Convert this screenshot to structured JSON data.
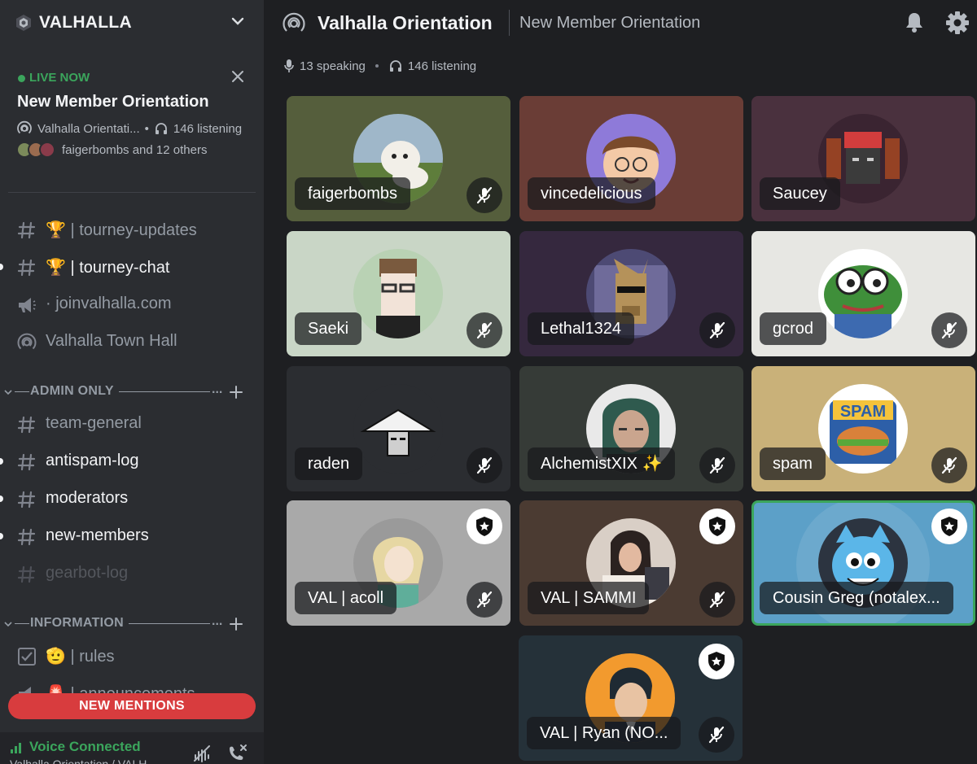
{
  "server": {
    "name": "VALHALLA"
  },
  "live": {
    "status": "LIVE NOW",
    "title": "New Member Orientation",
    "channel": "Valhalla Orientati...",
    "listening": "146 listening",
    "people": "faigerbombs and 12 others"
  },
  "channels": [
    {
      "label": "🏆 | tourney-updates",
      "type": "text",
      "state": "normal"
    },
    {
      "label": "🏆 | tourney-chat",
      "type": "text",
      "state": "unread"
    },
    {
      "label": "· joinvalhalla.com",
      "type": "announce",
      "state": "normal"
    },
    {
      "label": "Valhalla Town Hall",
      "type": "stage",
      "state": "normal"
    },
    {
      "label": "team-general",
      "type": "text",
      "state": "normal"
    },
    {
      "label": "antispam-log",
      "type": "text",
      "state": "unread"
    },
    {
      "label": "moderators",
      "type": "text",
      "state": "unread"
    },
    {
      "label": "new-members",
      "type": "text",
      "state": "unread"
    },
    {
      "label": "gearbot-log",
      "type": "text",
      "state": "muted"
    },
    {
      "label": "🫡 | rules",
      "type": "rules",
      "state": "normal"
    },
    {
      "label": "🚨 | announcements",
      "type": "announce",
      "state": "normal"
    }
  ],
  "categories": [
    {
      "label": "ADMIN ONLY",
      "dots": "..."
    },
    {
      "label": "INFORMATION",
      "dots": "..."
    }
  ],
  "new_mentions": "NEW MENTIONS",
  "voice": {
    "status": "Voice Connected",
    "sub": "Valhalla Orientation / VALH..."
  },
  "stage": {
    "title": "Valhalla Orientation",
    "topic": "New Member Orientation",
    "speaking": "13 speaking",
    "listening": "146 listening"
  },
  "speakers": [
    {
      "name": "faigerbombs",
      "tile_color": "#555e3c",
      "avatar": "dog-photo",
      "moderator": false,
      "speaking": false
    },
    {
      "name": "vincedelicious",
      "tile_color": "#6a3d36",
      "avatar": "cartoon-glasses",
      "moderator": false,
      "speaking": false
    },
    {
      "name": "Saucey",
      "tile_color": "#4a313e",
      "avatar": "pixel-creature",
      "moderator": false,
      "speaking": false
    },
    {
      "name": "Saeki",
      "tile_color": "#c9d6c6",
      "avatar": "pixel-face",
      "moderator": false,
      "speaking": false
    },
    {
      "name": "Lethal1324",
      "tile_color": "#35283e",
      "avatar": "pixel-llama",
      "moderator": false,
      "speaking": false
    },
    {
      "name": "gcrod",
      "tile_color": "#e7e7e3",
      "avatar": "pepe-frog",
      "moderator": false,
      "speaking": false
    },
    {
      "name": "raden",
      "tile_color": "#2b2d31",
      "avatar": "straw-hat",
      "moderator": false,
      "speaking": false
    },
    {
      "name": "AlchemistXIX ✨",
      "tile_color": "#363b37",
      "avatar": "anime-girl",
      "moderator": false,
      "speaking": false
    },
    {
      "name": "spam",
      "tile_color": "#c9b179",
      "avatar": "spam-can",
      "moderator": false,
      "speaking": false
    },
    {
      "name": "VAL | acoll",
      "tile_color": "#a9a9a9",
      "avatar": "anime-blonde",
      "moderator": true,
      "speaking": false
    },
    {
      "name": "VAL | SAMMI",
      "tile_color": "#4b3b32",
      "avatar": "photo-person",
      "moderator": true,
      "speaking": false
    },
    {
      "name": "Cousin Greg (notalex...",
      "tile_color": "#5ca0c8",
      "avatar": "blue-cat",
      "moderator": true,
      "speaking": true
    },
    {
      "name": "VAL | Ryan (NO...",
      "tile_color": "#253139",
      "avatar": "anime-suit",
      "moderator": true,
      "speaking": false
    }
  ]
}
